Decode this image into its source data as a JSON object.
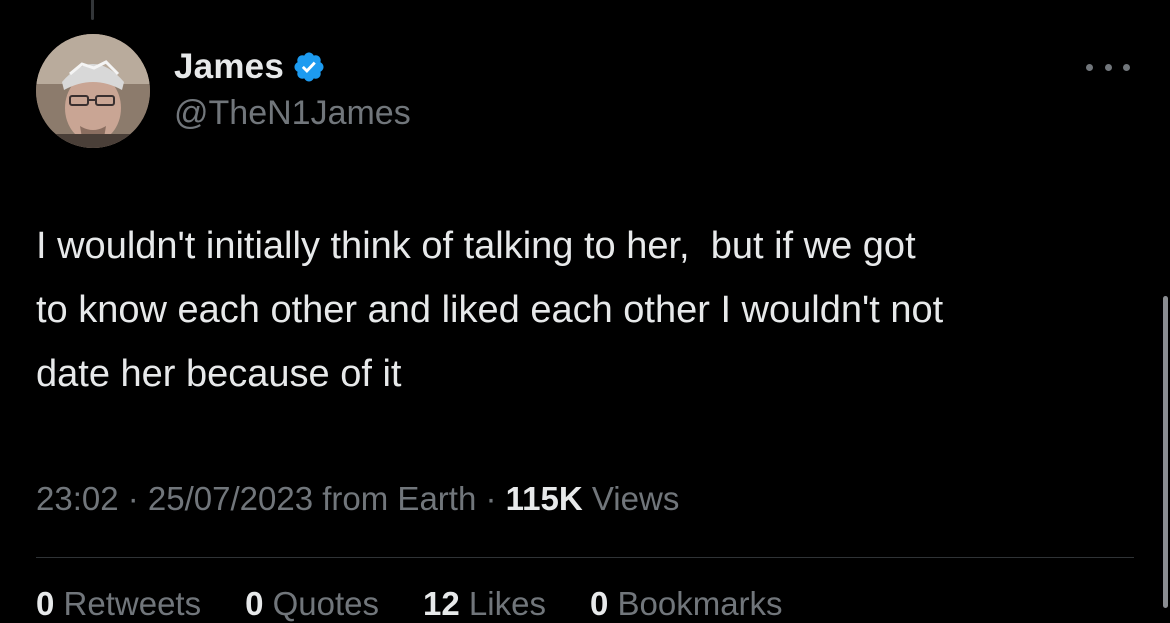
{
  "author": {
    "display_name": "James",
    "handle": "@TheN1James",
    "verified": true,
    "verified_color": "#1d9bf0",
    "avatar_icon": "profile-photo"
  },
  "tweet": {
    "text": "I wouldn't initially think of talking to her,  but if we got\nto know each other and liked each other I wouldn't not\ndate her because of it"
  },
  "meta": {
    "time": "23:02",
    "separator": " · ",
    "date": "25/07/2023",
    "source": "from Earth",
    "views_count": "115K",
    "views_label": "Views"
  },
  "stats": [
    {
      "num": "0",
      "label": "Retweets"
    },
    {
      "num": "0",
      "label": "Quotes"
    },
    {
      "num": "12",
      "label": "Likes"
    },
    {
      "num": "0",
      "label": "Bookmarks"
    }
  ],
  "colors": {
    "background": "#000000",
    "primary_text": "#e7e9ea",
    "secondary_text": "#71767b",
    "divider": "#2f3336"
  }
}
